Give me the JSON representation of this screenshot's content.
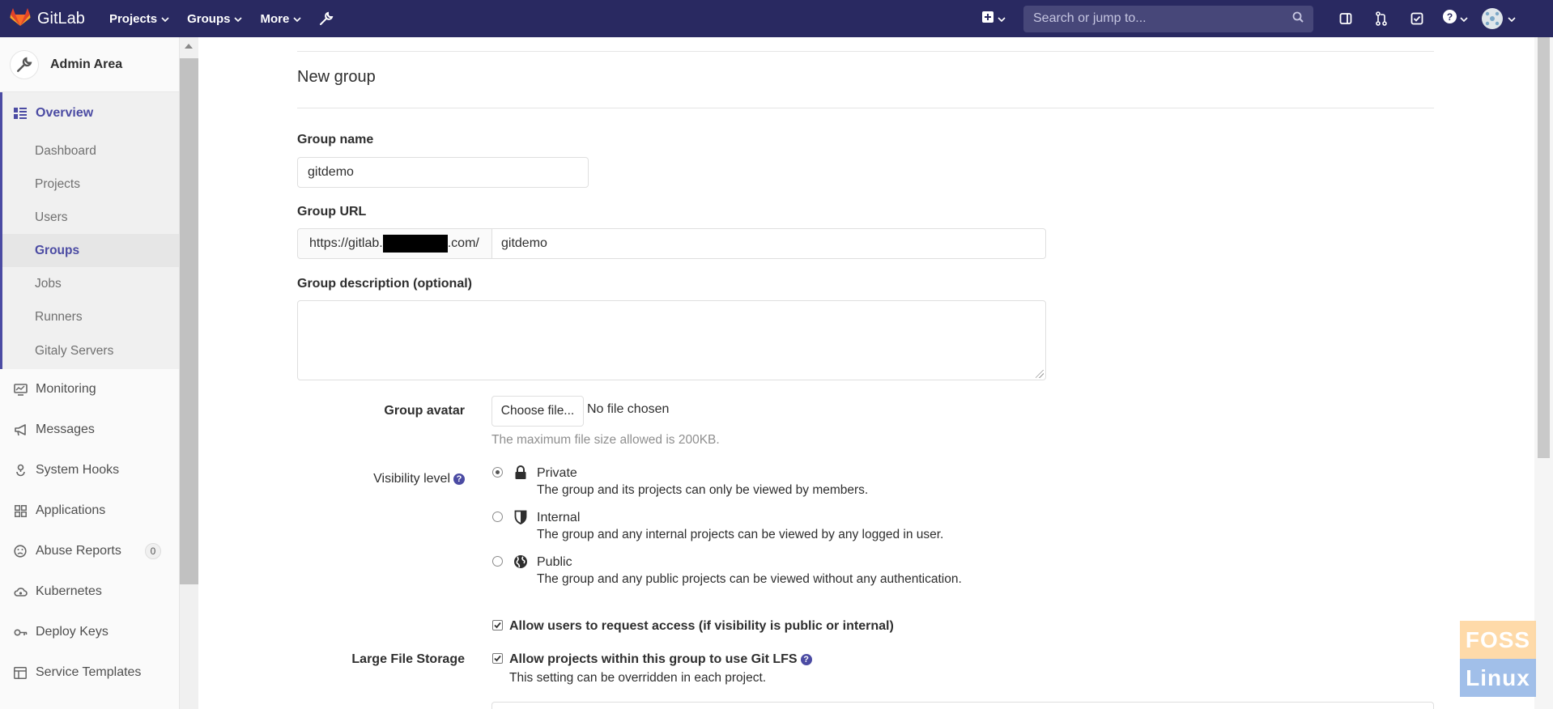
{
  "topbar": {
    "brand": "GitLab",
    "nav": [
      "Projects",
      "Groups",
      "More"
    ],
    "search_placeholder": "Search or jump to..."
  },
  "sidebar": {
    "title": "Admin Area",
    "overview": "Overview",
    "overview_items": [
      "Dashboard",
      "Projects",
      "Users",
      "Groups",
      "Jobs",
      "Runners",
      "Gitaly Servers"
    ],
    "active_item": "Groups",
    "items": [
      "Monitoring",
      "Messages",
      "System Hooks",
      "Applications",
      "Abuse Reports",
      "Kubernetes",
      "Deploy Keys",
      "Service Templates"
    ],
    "abuse_count": "0"
  },
  "form": {
    "page_title": "New group",
    "group_name_label": "Group name",
    "group_name_value": "gitdemo",
    "group_url_label": "Group URL",
    "url_prefix_start": "https://gitlab.",
    "url_prefix_end": ".com/",
    "group_path_value": "gitdemo",
    "description_label": "Group description (optional)",
    "avatar_label": "Group avatar",
    "choose_file": "Choose file...",
    "no_file": "No file chosen",
    "avatar_hint": "The maximum file size allowed is 200KB.",
    "visibility_label": "Visibility level",
    "visibility": [
      {
        "title": "Private",
        "desc": "The group and its projects can only be viewed by members.",
        "icon": "lock-icon",
        "selected": true
      },
      {
        "title": "Internal",
        "desc": "The group and any internal projects can be viewed by any logged in user.",
        "icon": "shield-icon",
        "selected": false
      },
      {
        "title": "Public",
        "desc": "The group and any public projects can be viewed without any authentication.",
        "icon": "globe-icon",
        "selected": false
      }
    ],
    "request_access_label": "Allow users to request access (if visibility is public or internal)",
    "lfs_section_label": "Large File Storage",
    "lfs_label": "Allow projects within this group to use Git LFS",
    "lfs_hint": "This setting can be overridden in each project."
  },
  "watermark": {
    "top": "FOSS",
    "bottom": "Linux"
  },
  "colors": {
    "nav_bg": "#292961",
    "accent": "#4b4ba3"
  }
}
